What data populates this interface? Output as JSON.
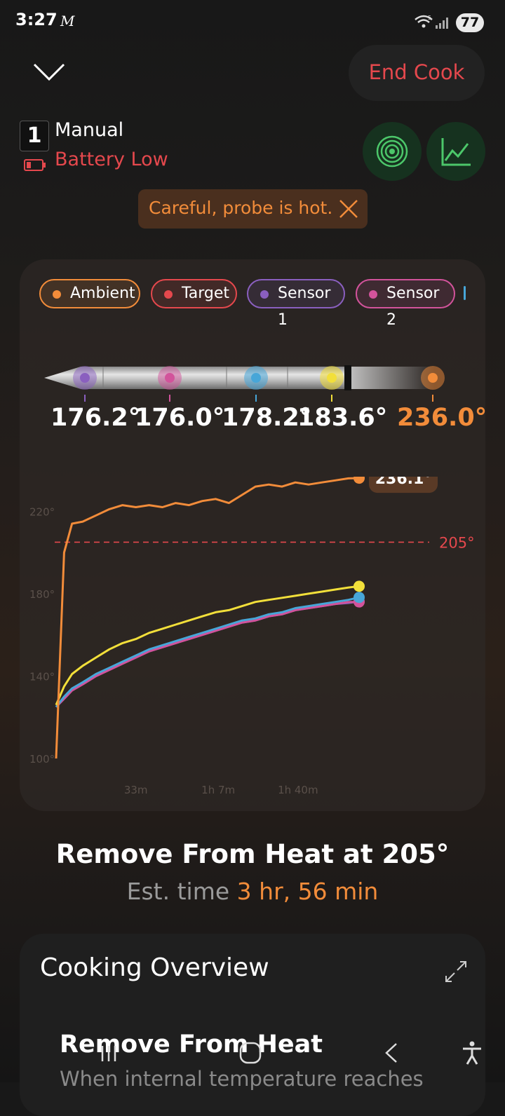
{
  "status_bar": {
    "time": "3:27",
    "carrier_icon": "M",
    "battery": "77",
    "signal": "5"
  },
  "header": {
    "end_cook_label": "End Cook"
  },
  "probe": {
    "number": "1",
    "mode": "Manual",
    "battery_status": "Battery Low"
  },
  "warning": {
    "text": "Careful, probe is hot."
  },
  "legend_chips": [
    {
      "label": "Ambient",
      "color": "#f28c3a"
    },
    {
      "label": "Target",
      "color": "#e5484d"
    },
    {
      "label": "Sensor 1",
      "color": "#8a5fbf"
    },
    {
      "label": "Sensor 2",
      "color": "#d2539b"
    }
  ],
  "probe_temps": [
    "176.2°",
    "176.0°",
    "178.2°",
    "183.6°",
    "236.0°"
  ],
  "colors": {
    "ambient": "#f28c3a",
    "target": "#e5484d",
    "sensor1": "#8a5fbf",
    "sensor2": "#d2539b",
    "sensor3": "#47a6d8",
    "sensor4": "#f2df3a"
  },
  "chart_data": {
    "type": "line",
    "y_ticks": [
      "220°",
      "180°",
      "140°",
      "100°"
    ],
    "x_ticks": [
      "33m",
      "1h 7m",
      "1h 40m"
    ],
    "target_label": "205°",
    "current_label": "236.1°",
    "target_value": 205,
    "ylim": [
      100,
      230
    ],
    "x_minutes": [
      0,
      3,
      6,
      10,
      15,
      20,
      25,
      30,
      35,
      40,
      45,
      50,
      55,
      60,
      65,
      70,
      75,
      80,
      85,
      90,
      95,
      100,
      105,
      110,
      114
    ],
    "series": [
      {
        "values": [
          100,
          200,
          214,
          215,
          218,
          221,
          223,
          222,
          223,
          222,
          224,
          223,
          225,
          226,
          224,
          228,
          232,
          233,
          232,
          234,
          233,
          234,
          235,
          236,
          236.1
        ]
      },
      {
        "values": [
          126,
          135,
          141,
          145,
          149,
          153,
          156,
          158,
          161,
          163,
          165,
          167,
          169,
          171,
          172,
          174,
          176,
          177,
          178,
          179,
          180,
          181,
          182,
          183,
          183.6
        ]
      },
      {
        "values": [
          125,
          130,
          134,
          137,
          141,
          144,
          147,
          150,
          153,
          155,
          157,
          159,
          161,
          163,
          165,
          167,
          168,
          170,
          171,
          173,
          174,
          175,
          176,
          177,
          178.2
        ]
      },
      {
        "values": [
          125,
          129,
          133,
          136,
          140,
          143,
          146,
          149,
          152,
          154,
          156,
          158,
          160,
          162,
          164,
          166,
          167,
          169,
          170,
          172,
          173,
          174,
          175,
          176,
          176.0
        ]
      },
      {
        "values": [
          125,
          129,
          133,
          136,
          140,
          143,
          146,
          149,
          152,
          154,
          156,
          158,
          160,
          162,
          164,
          166,
          167,
          169,
          170,
          172,
          173,
          174,
          175,
          175.5,
          176.2
        ]
      }
    ]
  },
  "summary": {
    "remove_heading": "Remove From Heat at 205°",
    "est_prefix": "Est. time",
    "est_value": "3 hr, 56 min"
  },
  "overview": {
    "title": "Cooking Overview",
    "heading": "Remove From Heat",
    "description": "When internal temperature reaches"
  }
}
